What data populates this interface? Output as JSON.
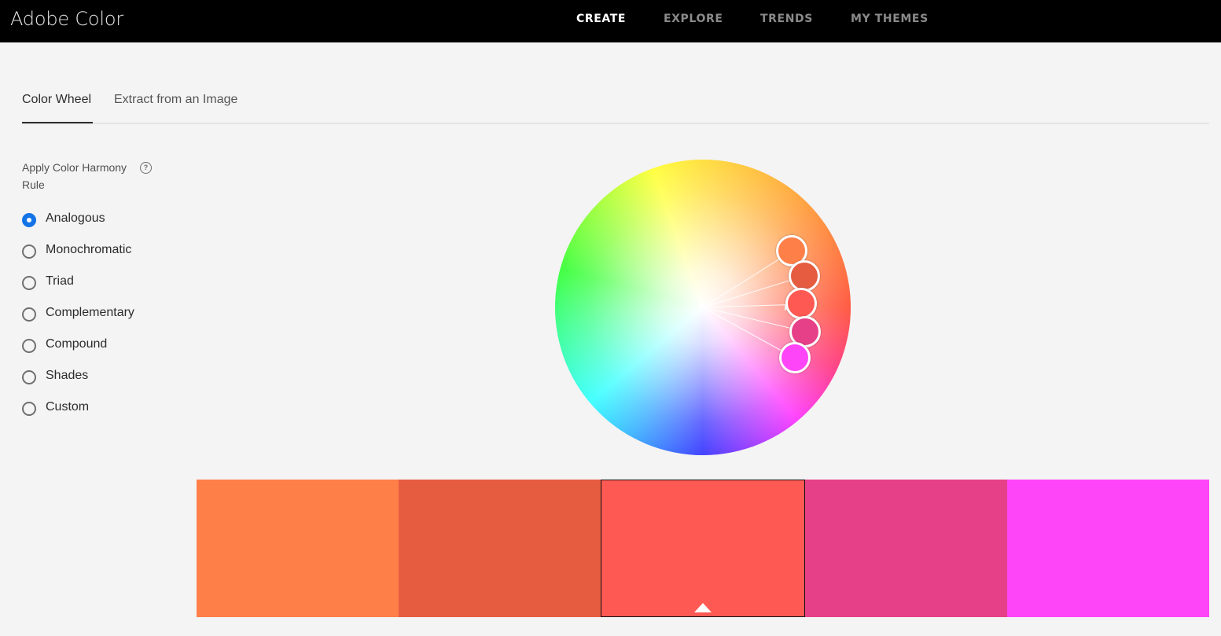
{
  "app": {
    "title": "Adobe Color"
  },
  "nav": {
    "items": [
      {
        "label": "CREATE",
        "active": true
      },
      {
        "label": "EXPLORE",
        "active": false
      },
      {
        "label": "TRENDS",
        "active": false
      },
      {
        "label": "MY THEMES",
        "active": false
      }
    ]
  },
  "tabs": [
    {
      "label": "Color Wheel",
      "active": true
    },
    {
      "label": "Extract from an Image",
      "active": false
    }
  ],
  "harmony": {
    "label": "Apply Color Harmony Rule",
    "help_icon": "question-circle-icon",
    "selected": "Analogous",
    "rules": [
      "Analogous",
      "Monochromatic",
      "Triad",
      "Complementary",
      "Compound",
      "Shades",
      "Custom"
    ]
  },
  "swatches": {
    "colors": [
      "#FF7F48",
      "#E65C40",
      "#FF5953",
      "#E64088",
      "#FF45F8"
    ],
    "selected_index": 2
  }
}
